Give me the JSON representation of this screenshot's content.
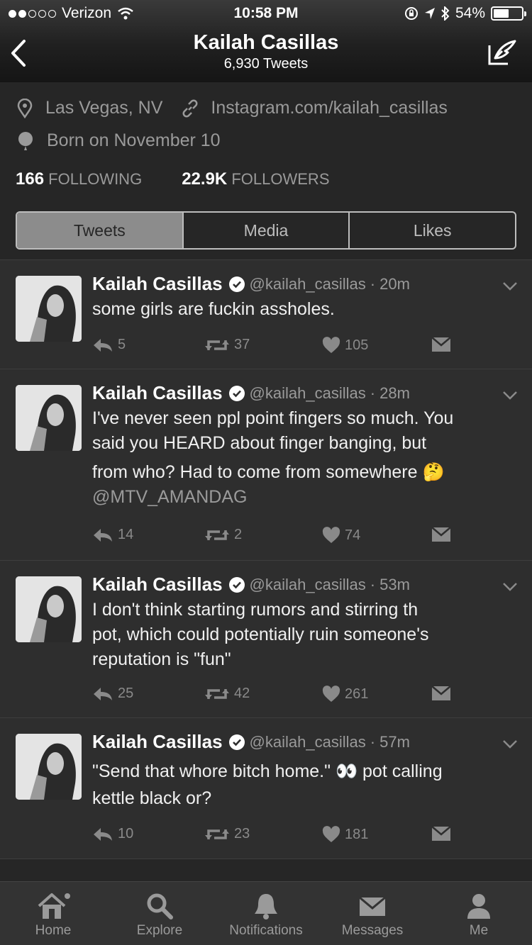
{
  "status_bar": {
    "carrier": "Verizon",
    "time": "10:58 PM",
    "battery": "54%",
    "battery_level": 0.54
  },
  "nav": {
    "title": "Kailah Casillas",
    "subtitle": "6,930 Tweets"
  },
  "profile": {
    "location": "Las Vegas, NV",
    "website": "Instagram.com/kailah_casillas",
    "birthday": "Born on November 10",
    "following_count": "166",
    "following_label": "FOLLOWING",
    "followers_count": "22.9K",
    "followers_label": "FOLLOWERS"
  },
  "segments": [
    "Tweets",
    "Media",
    "Likes"
  ],
  "tweets": [
    {
      "name": "Kailah Casillas",
      "handle": "@kailah_casillas",
      "time": "· 20m",
      "lines": [
        "some girls are fuckin assholes."
      ],
      "mention": "",
      "replies": "5",
      "retweets": "37",
      "likes": "105"
    },
    {
      "name": "Kailah Casillas",
      "handle": "@kailah_casillas",
      "time": "· 28m",
      "lines": [
        "I've never seen ppl point fingers so much. You",
        "said you HEARD about finger banging, but",
        "from who? Had to come from somewhere 🤔"
      ],
      "mention": "@MTV_AMANDAG",
      "replies": "14",
      "retweets": "2",
      "likes": "74"
    },
    {
      "name": "Kailah Casillas",
      "handle": "@kailah_casillas",
      "time": "· 53m",
      "lines": [
        "I don't think starting rumors and stirring th",
        "pot, which could potentially ruin someone's",
        "reputation is \"fun\""
      ],
      "mention": "",
      "replies": "25",
      "retweets": "42",
      "likes": "261"
    },
    {
      "name": "Kailah Casillas",
      "handle": "@kailah_casillas",
      "time": "· 57m",
      "lines": [
        "\"Send that whore bitch home.\" 👀 pot calling",
        "kettle black or?"
      ],
      "mention": "",
      "replies": "10",
      "retweets": "23",
      "likes": "181"
    }
  ],
  "tabs": [
    "Home",
    "Explore",
    "Notifications",
    "Messages",
    "Me"
  ],
  "icons": [
    "back-icon",
    "compose-icon",
    "location-icon",
    "link-icon",
    "birthday-icon",
    "verified-icon",
    "reply-icon",
    "retweet-icon",
    "heart-icon",
    "dm-icon",
    "home-icon",
    "search-icon",
    "bell-icon",
    "mail-icon",
    "person-icon"
  ]
}
